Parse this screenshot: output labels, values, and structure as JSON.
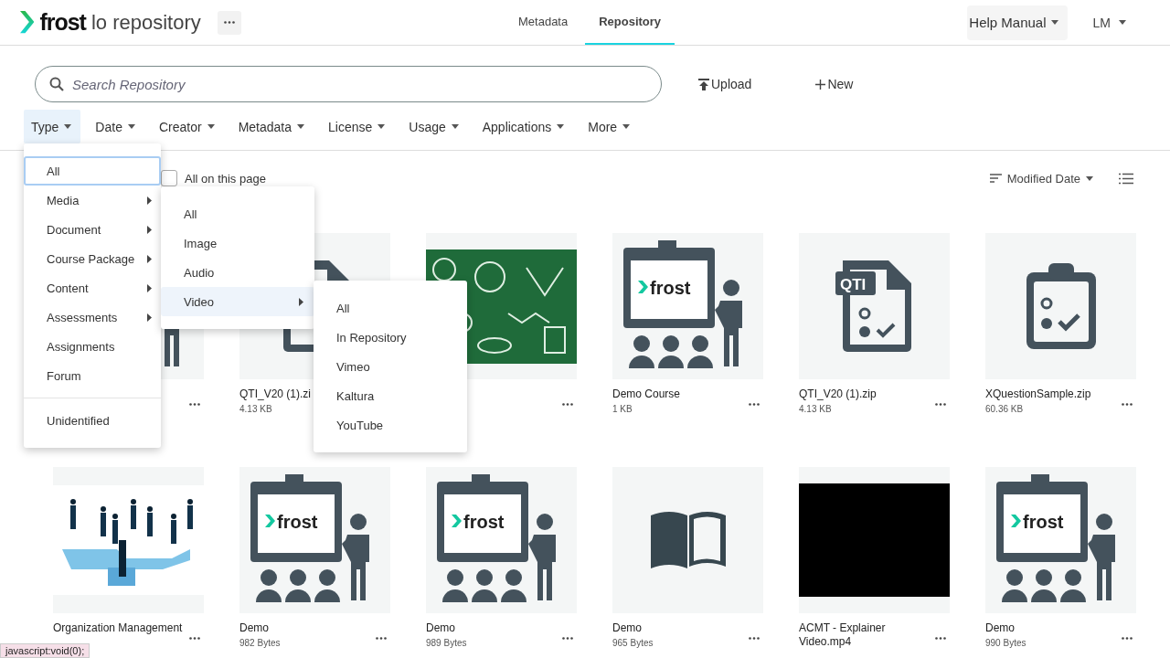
{
  "header": {
    "logo": "frost",
    "app_name": "lo repository",
    "nav_tabs": [
      {
        "label": "Metadata",
        "selected": false
      },
      {
        "label": "Repository",
        "selected": true
      }
    ],
    "help": "Help Manual",
    "user": "LM"
  },
  "search": {
    "placeholder": "Search Repository"
  },
  "actions": [
    {
      "label": "Upload",
      "kind": "upload"
    },
    {
      "label": "New",
      "kind": "new"
    }
  ],
  "filters": [
    {
      "label": "Type",
      "selected": true
    },
    {
      "label": "Date",
      "selected": false
    },
    {
      "label": "Creator",
      "selected": false
    },
    {
      "label": "Metadata",
      "selected": false
    },
    {
      "label": "License",
      "selected": false
    },
    {
      "label": "Usage",
      "selected": false
    },
    {
      "label": "Applications",
      "selected": false
    },
    {
      "label": "More",
      "selected": false
    }
  ],
  "select_all": {
    "label": "All on this page",
    "checked": false
  },
  "sort": {
    "label": "Modified Date"
  },
  "cards": [
    {
      "kind": "figure"
    },
    {
      "name": "QTI_V20 (1).zi",
      "size": "4.13 KB",
      "kind": "file"
    },
    {
      "kind": "picture"
    },
    {
      "name": "Demo Course",
      "size": "1 KB",
      "kind": "presenter",
      "logo": "frost"
    },
    {
      "name": "QTI_V20 (1).zip",
      "size": "4.13 KB",
      "kind": "qti",
      "logo": "QTI"
    },
    {
      "name": "XQuestionSample.zip",
      "size": "60.36 KB",
      "kind": "clipboard"
    },
    {
      "name": "Organization Management",
      "kind": "picture"
    },
    {
      "name": "Demo",
      "size": "982 Bytes",
      "kind": "presenter",
      "logo": "frost"
    },
    {
      "name": "Demo",
      "size": "989 Bytes",
      "kind": "presenter",
      "logo": "frost"
    },
    {
      "name": "Demo",
      "size": "965 Bytes",
      "kind": "book"
    },
    {
      "name": "ACMT - Explainer Video.mp4",
      "kind": "video"
    },
    {
      "name": "Demo",
      "size": "990 Bytes",
      "kind": "presenter",
      "logo": "frost"
    }
  ],
  "type_menu": [
    {
      "label": "All",
      "selected": true,
      "submenu": false
    },
    {
      "label": "Media",
      "selected": false,
      "submenu": true
    },
    {
      "label": "Document",
      "selected": false,
      "submenu": true
    },
    {
      "label": "Course Package",
      "selected": false,
      "submenu": true
    },
    {
      "label": "Content",
      "selected": false,
      "submenu": true
    },
    {
      "label": "Assessments",
      "selected": false,
      "submenu": true
    },
    {
      "label": "Assignments",
      "selected": false,
      "submenu": false
    },
    {
      "label": "Forum",
      "selected": false,
      "submenu": false
    },
    {
      "label": "Unidentified",
      "selected": false,
      "submenu": false,
      "separated": true
    }
  ],
  "media_menu": [
    {
      "label": "All",
      "selected": false,
      "submenu": false
    },
    {
      "label": "Image",
      "selected": false,
      "submenu": false
    },
    {
      "label": "Audio",
      "selected": false,
      "submenu": false
    },
    {
      "label": "Video",
      "selected": true,
      "submenu": true
    }
  ],
  "video_menu": [
    {
      "label": "All",
      "selected": false
    },
    {
      "label": "In Repository",
      "selected": false
    },
    {
      "label": "Vimeo",
      "selected": false
    },
    {
      "label": "Kaltura",
      "selected": false
    },
    {
      "label": "YouTube",
      "selected": false
    }
  ],
  "status_bar": "javascript:void(0);"
}
